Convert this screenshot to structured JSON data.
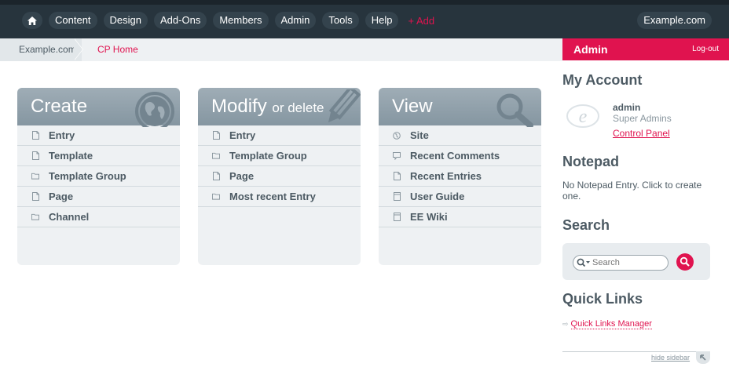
{
  "nav": {
    "home_icon": "home-icon",
    "items": [
      "Content",
      "Design",
      "Add-Ons",
      "Members",
      "Admin",
      "Tools",
      "Help"
    ],
    "add_label": "+ Add",
    "site_label": "Example.com"
  },
  "breadcrumb": {
    "site": "Example.com",
    "current": "CP Home"
  },
  "panels": {
    "create": {
      "title": "Create",
      "icon": "globe-icon",
      "rows": [
        "Entry",
        "Template",
        "Template Group",
        "Page",
        "Channel"
      ]
    },
    "modify": {
      "title": "Modify",
      "subtitle": "or delete",
      "icon": "pencil-icon",
      "rows": [
        "Entry",
        "Template Group",
        "Page",
        "Most recent Entry"
      ]
    },
    "view": {
      "title": "View",
      "icon": "magnifier-icon",
      "rows": [
        "Site",
        "Recent Comments",
        "Recent Entries",
        "User Guide",
        "EE Wiki"
      ]
    }
  },
  "sidebar": {
    "admin_title": "Admin",
    "logout": "Log-out",
    "my_account_heading": "My Account",
    "username": "admin",
    "group": "Super Admins",
    "control_panel_link": "Control Panel",
    "notepad_heading": "Notepad",
    "notepad_text": "No Notepad Entry. Click to create one.",
    "search_heading": "Search",
    "search_placeholder": "Search",
    "quick_links_heading": "Quick Links",
    "quick_links_manager": "Quick Links Manager",
    "hide_sidebar": "hide sidebar"
  },
  "colors": {
    "accent": "#e0134f",
    "topbar": "#27343d",
    "panel_header": "#8f9fa9",
    "text": "#4c5a63"
  }
}
